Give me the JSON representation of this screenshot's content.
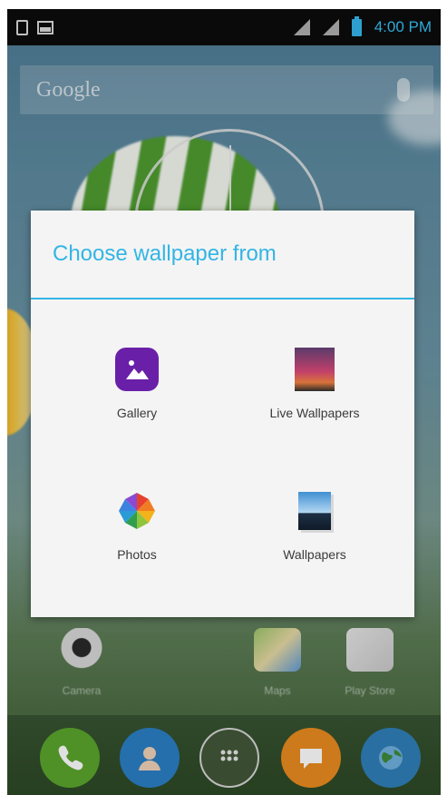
{
  "status_bar": {
    "time": "4:00 PM",
    "left_icons": [
      "sim-card-icon",
      "screenshot-image-icon"
    ],
    "right_icons": [
      "signal-icon",
      "signal-2-icon",
      "battery-icon"
    ],
    "colors": {
      "time": "#2ea9d8",
      "background": "#0a0a0a"
    }
  },
  "search": {
    "label": "Google",
    "icon": "mic-icon"
  },
  "dialog": {
    "title": "Choose wallpaper from",
    "accent_color": "#33b5e5",
    "options": [
      {
        "label": "Gallery",
        "icon": "gallery-icon"
      },
      {
        "label": "Live Wallpapers",
        "icon": "live-wallpapers-icon"
      },
      {
        "label": "Photos",
        "icon": "photos-icon"
      },
      {
        "label": "Wallpapers",
        "icon": "wallpapers-icon"
      }
    ]
  },
  "home_apps": [
    {
      "label": "Camera",
      "icon": "camera-icon"
    },
    {
      "label": "Maps",
      "icon": "maps-icon"
    },
    {
      "label": "Play Store",
      "icon": "play-store-icon"
    }
  ],
  "dock": [
    {
      "icon": "phone-icon",
      "color": "#5aa62c"
    },
    {
      "icon": "contacts-icon",
      "color": "#2b7fc4"
    },
    {
      "icon": "app-drawer-icon",
      "color": "#55614a"
    },
    {
      "icon": "messaging-icon",
      "color": "#e98b1f"
    },
    {
      "icon": "browser-icon",
      "color": "#2f7fb8"
    }
  ]
}
